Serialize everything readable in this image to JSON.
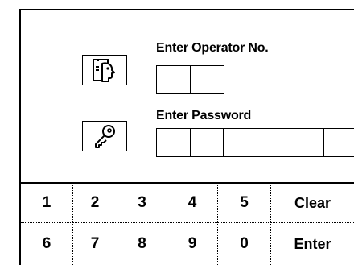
{
  "login": {
    "operator_label": "Enter Operator No.",
    "password_label": "Enter Password",
    "operator_icon": "operator-id-icon",
    "password_icon": "key-icon"
  },
  "keypad": {
    "row1": [
      "1",
      "2",
      "3",
      "4",
      "5",
      "Clear"
    ],
    "row2": [
      "6",
      "7",
      "8",
      "9",
      "0",
      "Enter"
    ]
  }
}
